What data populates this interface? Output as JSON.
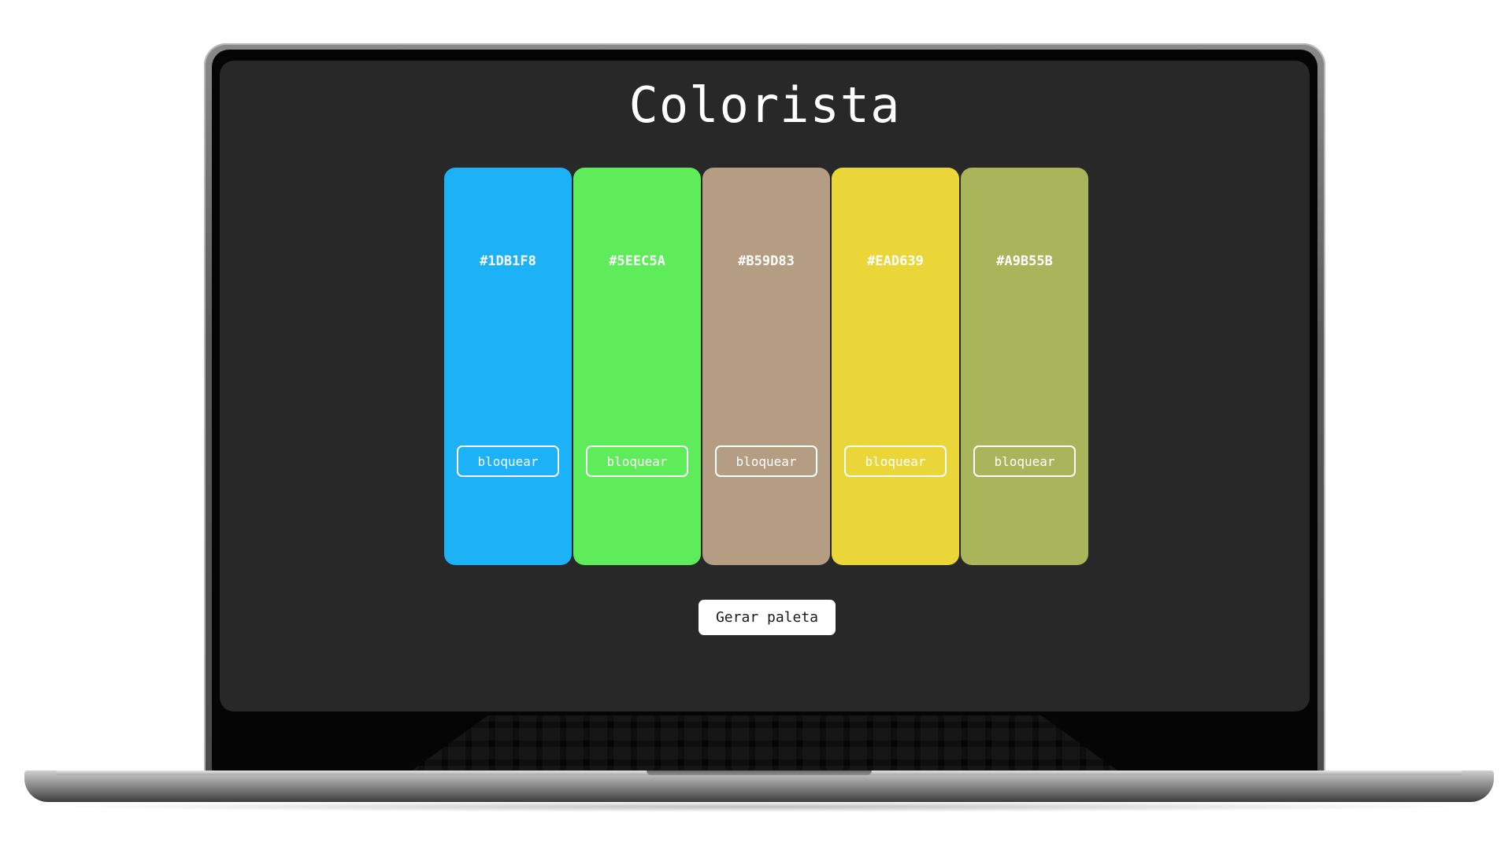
{
  "app": {
    "title": "Colorista"
  },
  "palette": [
    {
      "hex": "#1DB1F8",
      "color": "#1DB1F8",
      "lock_label": "bloquear"
    },
    {
      "hex": "#5EEC5A",
      "color": "#5EEC5A",
      "lock_label": "bloquear"
    },
    {
      "hex": "#B59D83",
      "color": "#B59D83",
      "lock_label": "bloquear"
    },
    {
      "hex": "#EAD639",
      "color": "#EAD639",
      "lock_label": "bloquear"
    },
    {
      "hex": "#A9B55B",
      "color": "#A9B55B",
      "lock_label": "bloquear"
    }
  ],
  "actions": {
    "generate_label": "Gerar paleta"
  },
  "theme": {
    "screen_background": "#282828",
    "text": "#FFFFFF"
  }
}
